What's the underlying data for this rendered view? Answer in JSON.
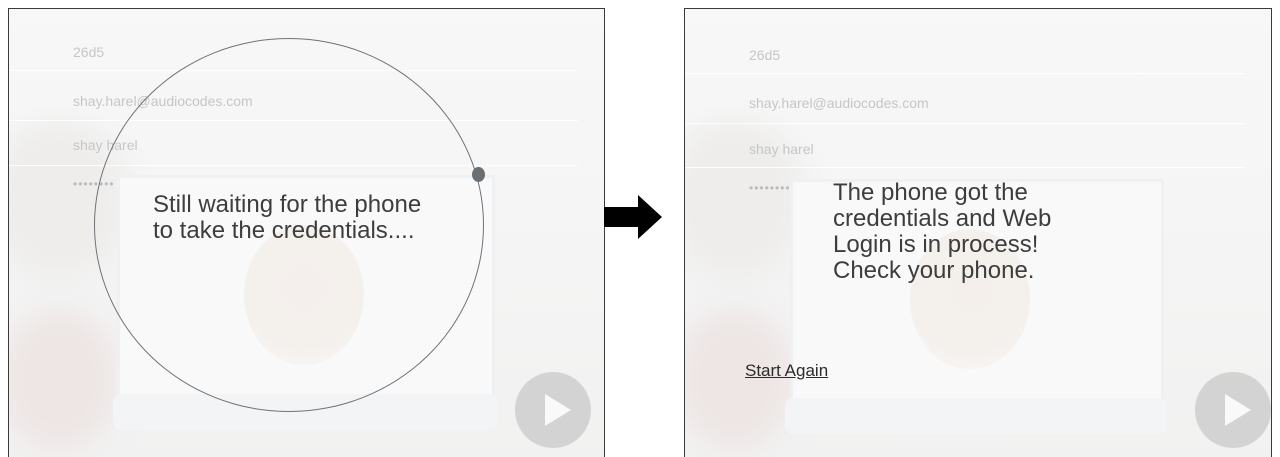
{
  "left_panel": {
    "code_value": "26d5",
    "email_value": "shay.harel@audiocodes.com",
    "name_value": "shay harel",
    "password_mask": "••••••••",
    "message": "Still waiting for the phone to take the credentials...."
  },
  "right_panel": {
    "code_value": "26d5",
    "email_value": "shay.harel@audiocodes.com",
    "name_value": "shay harel",
    "password_mask": "••••••••",
    "message": "The phone got the credentials and Web Login is in process! Check your phone.",
    "start_again_label": "Start Again"
  },
  "icons": {
    "arrow": "right-arrow-icon",
    "play": "play-icon"
  },
  "colors": {
    "text": "#3d3d3d",
    "faded_text": "#c4c6c8",
    "circle": "#6e7378"
  }
}
